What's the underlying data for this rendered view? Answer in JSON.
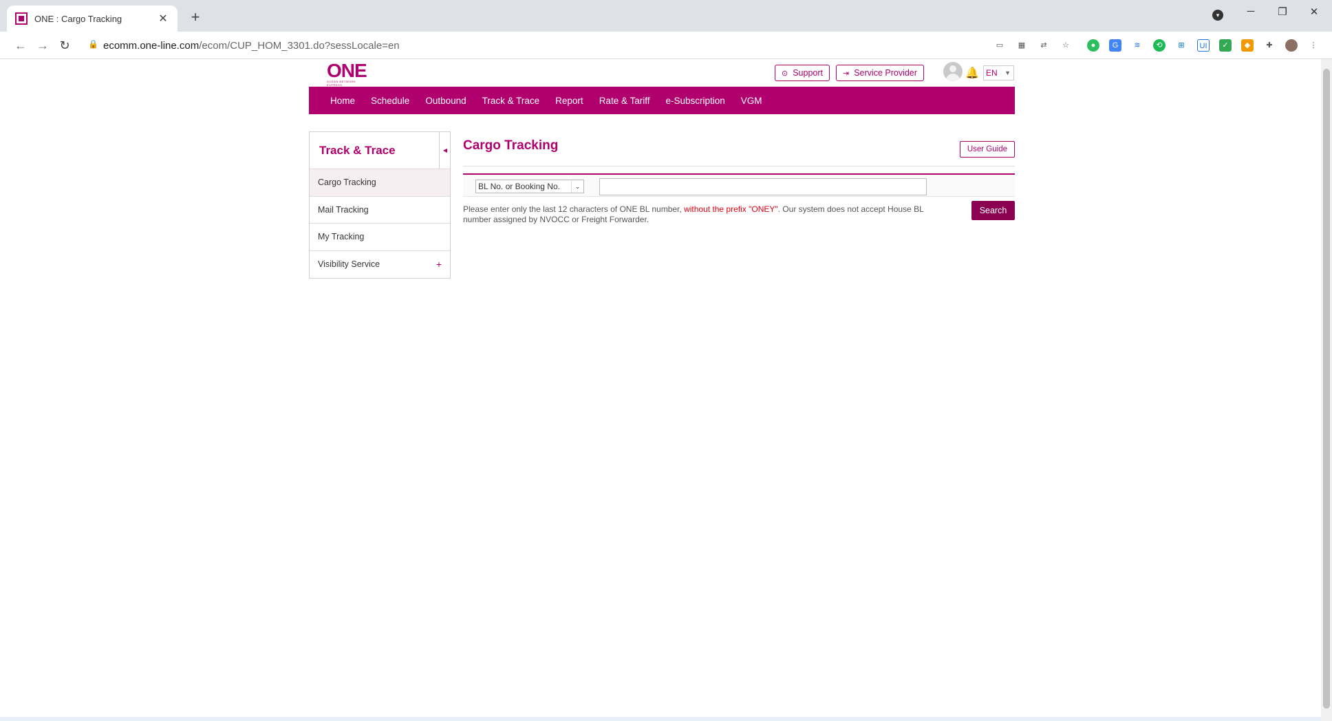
{
  "browser": {
    "tab_title": "ONE : Cargo Tracking",
    "tab_close": "✕",
    "new_tab": "+",
    "url_host": "ecomm.one-line.com",
    "url_path": "/ecom/CUP_HOM_3301.do?sessLocale=en",
    "window_controls": {
      "minimize": "─",
      "restore": "❐",
      "close": "✕"
    }
  },
  "header": {
    "logo_text": "ONE",
    "logo_sub": "OCEAN NETWORK EXPRESS",
    "support_label": "Support",
    "service_provider_label": "Service Provider",
    "language": "EN"
  },
  "menu": {
    "items": [
      "Home",
      "Schedule",
      "Outbound",
      "Track & Trace",
      "Report",
      "Rate & Tariff",
      "e-Subscription",
      "VGM"
    ]
  },
  "sidebar": {
    "title": "Track & Trace",
    "items": [
      {
        "label": "Cargo Tracking"
      },
      {
        "label": "Mail Tracking"
      },
      {
        "label": "My Tracking"
      },
      {
        "label": "Visibility Service"
      }
    ],
    "expand_symbol": "+"
  },
  "main": {
    "page_title": "Cargo Tracking",
    "user_guide_label": "User Guide",
    "search_type_selected": "BL No. or Booking No.",
    "search_input_value": "",
    "note_part1": "Please enter only the last 12 characters of ONE BL number, ",
    "note_highlight": "without the prefix \"ONEY\"",
    "note_part2": ". Our system does not accept House BL number assigned by NVOCC or Freight Forwarder.",
    "search_label": "Search"
  },
  "colors": {
    "brand": "#b0006d",
    "search_button": "#8b0050",
    "warning_text": "#e60012"
  }
}
